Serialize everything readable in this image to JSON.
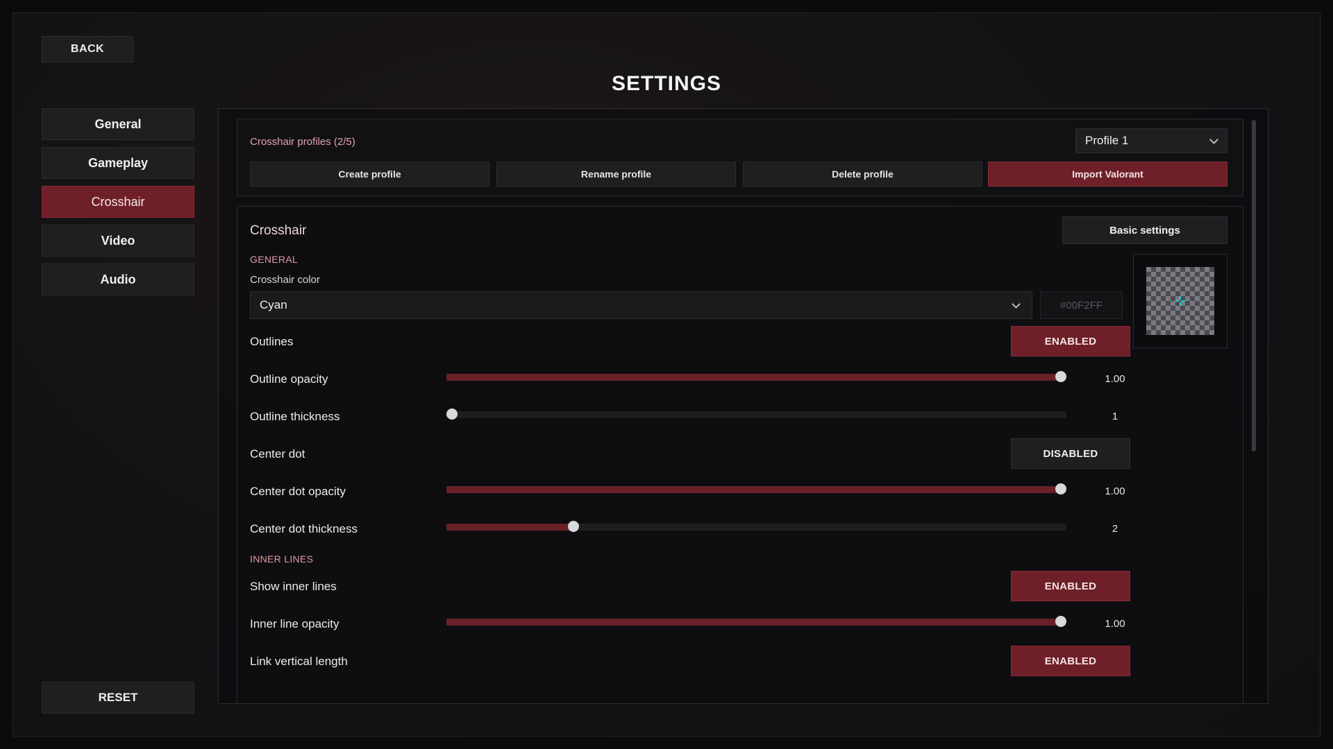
{
  "header": {
    "back_label": "BACK",
    "title": "SETTINGS"
  },
  "sidebar": {
    "items": [
      {
        "label": "General"
      },
      {
        "label": "Gameplay"
      },
      {
        "label": "Crosshair"
      },
      {
        "label": "Video"
      },
      {
        "label": "Audio"
      }
    ],
    "active": "Crosshair",
    "reset_label": "RESET"
  },
  "profiles": {
    "title": "Crosshair profiles (2/5)",
    "selected": "Profile 1",
    "buttons": {
      "create": "Create profile",
      "rename": "Rename profile",
      "delete": "Delete profile",
      "import": "Import Valorant"
    }
  },
  "crosshair": {
    "title": "Crosshair",
    "basic_settings_label": "Basic settings",
    "general_heading": "GENERAL",
    "color_label": "Crosshair color",
    "color_value": "Cyan",
    "color_hex": "#00F2FF",
    "outlines": {
      "label": "Outlines",
      "state": "ENABLED"
    },
    "outline_opacity": {
      "label": "Outline opacity",
      "value": "1.00",
      "fraction": 1.0
    },
    "outline_thickness": {
      "label": "Outline thickness",
      "value": "1",
      "fraction": 0.0
    },
    "center_dot": {
      "label": "Center dot",
      "state": "DISABLED"
    },
    "center_dot_opacity": {
      "label": "Center dot opacity",
      "value": "1.00",
      "fraction": 1.0
    },
    "center_dot_thickness": {
      "label": "Center dot thickness",
      "value": "2",
      "fraction": 0.2
    },
    "inner_lines_heading": "INNER LINES",
    "show_inner_lines": {
      "label": "Show inner lines",
      "state": "ENABLED"
    },
    "inner_line_opacity": {
      "label": "Inner line opacity",
      "value": "1.00",
      "fraction": 1.0
    },
    "link_vertical_length": {
      "label": "Link vertical length",
      "state": "ENABLED"
    }
  },
  "colors": {
    "accent": "#6e1f28",
    "accent_text": "#e1a4ac",
    "crosshair": "#00F2FF"
  }
}
